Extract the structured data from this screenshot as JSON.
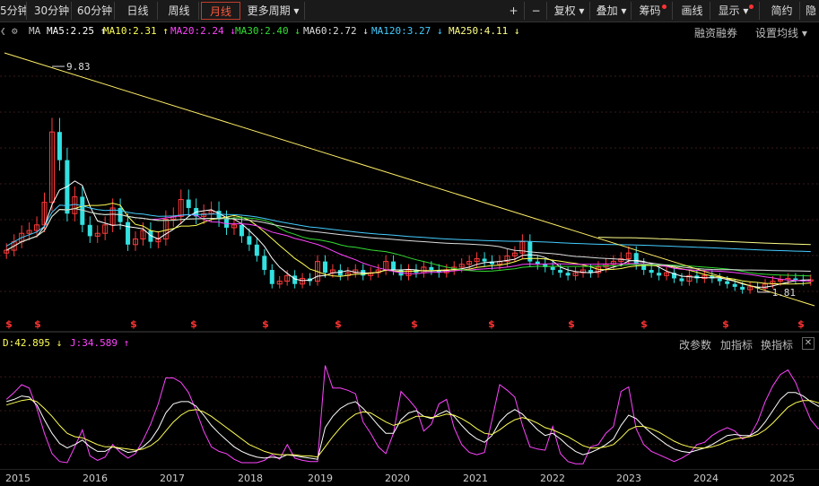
{
  "toolbar": {
    "periods": [
      "5分钟",
      "30分钟",
      "60分钟",
      "日线",
      "周线",
      "月线",
      "更多周期 ▾"
    ],
    "active_period": "月线",
    "right": [
      "+",
      "−",
      "复权 ▾",
      "叠加 ▾",
      "筹码",
      "画线",
      "显示 ▾",
      "简约",
      "隐"
    ]
  },
  "ma_bar": {
    "label": "MA",
    "items": [
      {
        "text": "MA5:2.25",
        "arrow": "↑",
        "color": "#ffffff"
      },
      {
        "text": "MA10:2.31",
        "arrow": "↑",
        "color": "#ffff55"
      },
      {
        "text": "MA20:2.24",
        "arrow": "↓",
        "color": "#ff44ff"
      },
      {
        "text": "MA30:2.40",
        "arrow": "↓",
        "color": "#33dd33"
      },
      {
        "text": "MA60:2.72",
        "arrow": "↓",
        "color": "#dddddd"
      },
      {
        "text": "MA120:3.27",
        "arrow": "↓",
        "color": "#44ccff"
      },
      {
        "text": "MA250:4.11",
        "arrow": "↓",
        "color": "#ffff88"
      }
    ],
    "links": [
      "融资融券",
      "设置均线 ▾"
    ]
  },
  "kdj_bar": {
    "items": [
      {
        "text": "D:42.895",
        "arrow": "↓",
        "color": "#ffff55"
      },
      {
        "text": "J:34.589",
        "arrow": "↑",
        "color": "#ff44ff"
      }
    ],
    "links": [
      "改参数",
      "加指标",
      "换指标"
    ],
    "close": "✕"
  },
  "chart_data": [
    {
      "type": "candlestick",
      "period": "monthly",
      "x_labels": [
        "2015",
        "2016",
        "2017",
        "2018",
        "2019",
        "2020",
        "2021",
        "2022",
        "2023",
        "2024",
        "2025"
      ],
      "price_range": [
        1.2,
        10.5
      ],
      "high_marker": {
        "text": "9.83",
        "value": 9.83
      },
      "low_marker": {
        "text": "1.81",
        "value": 1.81
      },
      "closes": [
        3.3,
        3.6,
        3.9,
        4.0,
        4.2,
        5.0,
        7.5,
        6.5,
        4.6,
        5.2,
        4.2,
        3.8,
        3.9,
        4.2,
        4.8,
        4.3,
        3.5,
        3.7,
        4.0,
        3.6,
        3.7,
        4.4,
        4.5,
        5.1,
        4.8,
        4.5,
        4.6,
        4.7,
        4.4,
        4.1,
        4.2,
        3.8,
        3.5,
        3.1,
        2.6,
        2.1,
        2.2,
        2.4,
        2.1,
        2.3,
        2.2,
        2.9,
        2.5,
        2.6,
        2.4,
        2.5,
        2.6,
        2.4,
        2.5,
        2.6,
        2.9,
        2.6,
        2.4,
        2.6,
        2.5,
        2.7,
        2.6,
        2.5,
        2.6,
        2.7,
        2.8,
        2.9,
        3.0,
        2.9,
        2.8,
        2.9,
        3.1,
        3.2,
        3.6,
        2.9,
        2.8,
        2.7,
        2.6,
        2.5,
        2.4,
        2.5,
        2.6,
        2.5,
        2.7,
        2.8,
        2.9,
        3.0,
        3.2,
        2.8,
        2.6,
        2.5,
        2.4,
        2.5,
        2.3,
        2.2,
        2.4,
        2.3,
        2.4,
        2.3,
        2.2,
        2.1,
        2.0,
        1.9,
        2.0,
        1.95,
        2.1,
        2.2,
        2.25,
        2.3,
        2.25,
        2.2,
        2.25
      ],
      "ma_series": [
        {
          "name": "MA5",
          "color": "#ffffff"
        },
        {
          "name": "MA10",
          "color": "#ffff55"
        },
        {
          "name": "MA20",
          "color": "#ff44ff"
        },
        {
          "name": "MA30",
          "color": "#33dd33"
        },
        {
          "name": "MA60",
          "color": "#dddddd"
        },
        {
          "name": "MA120",
          "color": "#44ccff"
        },
        {
          "name": "MA250",
          "color": "#ffff88"
        }
      ],
      "dividend_marks": [
        "$",
        "$",
        "$",
        "$",
        "$",
        "$",
        "$",
        "$",
        "$",
        "$",
        "$",
        "$",
        "$",
        "$"
      ]
    },
    {
      "type": "line",
      "indicator": "KDJ",
      "series": [
        {
          "name": "J",
          "color": "#ff44ff",
          "values": [
            60,
            66,
            73,
            70,
            52,
            30,
            12,
            5,
            4,
            18,
            33,
            10,
            6,
            9,
            20,
            13,
            8,
            12,
            24,
            38,
            56,
            79,
            79,
            75,
            66,
            50,
            32,
            18,
            14,
            12,
            7,
            4,
            4,
            4,
            6,
            11,
            7,
            20,
            8,
            6,
            5,
            5,
            90,
            70,
            70,
            68,
            65,
            40,
            30,
            18,
            12,
            30,
            67,
            60,
            52,
            32,
            38,
            56,
            60,
            35,
            20,
            13,
            11,
            13,
            42,
            73,
            68,
            62,
            37,
            18,
            16,
            15,
            36,
            12,
            5,
            3,
            3,
            18,
            20,
            30,
            36,
            67,
            71,
            34,
            20,
            14,
            11,
            8,
            5,
            8,
            12,
            20,
            22,
            28,
            32,
            35,
            32,
            25,
            28,
            40,
            58,
            72,
            82,
            86,
            75,
            58,
            42,
            34,
            38
          ]
        },
        {
          "name": "K",
          "color": "#ffffff",
          "values": [
            58,
            60,
            63,
            62,
            55,
            42,
            30,
            21,
            17,
            20,
            24,
            18,
            14,
            14,
            18,
            16,
            13,
            14,
            18,
            24,
            34,
            48,
            56,
            58,
            58,
            54,
            46,
            37,
            30,
            24,
            18,
            14,
            11,
            9,
            8,
            9,
            8,
            11,
            10,
            9,
            8,
            7,
            35,
            45,
            52,
            56,
            58,
            52,
            45,
            37,
            30,
            30,
            42,
            48,
            50,
            45,
            43,
            47,
            50,
            45,
            37,
            30,
            25,
            22,
            28,
            40,
            47,
            51,
            47,
            40,
            33,
            28,
            30,
            25,
            19,
            14,
            11,
            13,
            16,
            20,
            25,
            37,
            46,
            43,
            36,
            30,
            25,
            20,
            16,
            14,
            13,
            15,
            17,
            20,
            24,
            28,
            29,
            28,
            28,
            32,
            40,
            50,
            60,
            66,
            66,
            63,
            58,
            54,
            52
          ]
        },
        {
          "name": "D",
          "color": "#ffff55",
          "values": [
            55,
            57,
            59,
            60,
            58,
            52,
            45,
            37,
            30,
            27,
            26,
            23,
            20,
            18,
            18,
            17,
            16,
            15,
            16,
            19,
            24,
            32,
            40,
            46,
            50,
            51,
            49,
            45,
            40,
            35,
            30,
            25,
            20,
            17,
            14,
            12,
            11,
            11,
            11,
            10,
            10,
            9,
            18,
            27,
            35,
            42,
            47,
            49,
            48,
            44,
            40,
            37,
            39,
            42,
            45,
            45,
            44,
            45,
            47,
            46,
            43,
            39,
            34,
            30,
            29,
            33,
            38,
            42,
            44,
            42,
            39,
            35,
            33,
            30,
            27,
            23,
            19,
            17,
            17,
            18,
            20,
            26,
            33,
            36,
            36,
            34,
            31,
            27,
            23,
            20,
            18,
            17,
            17,
            18,
            20,
            23,
            25,
            26,
            27,
            29,
            33,
            39,
            46,
            53,
            57,
            59,
            59,
            57,
            55
          ]
        }
      ],
      "y_range": [
        0,
        100
      ],
      "current": {
        "D": 42.895,
        "J": 34.589
      }
    }
  ]
}
